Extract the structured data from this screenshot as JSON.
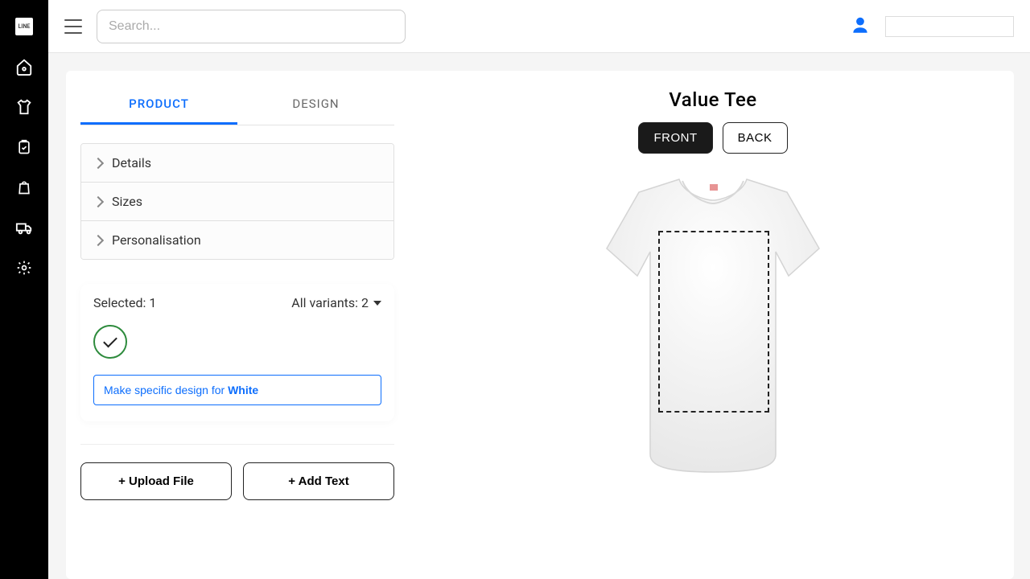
{
  "search": {
    "placeholder": "Search..."
  },
  "tabs": {
    "product": "PRODUCT",
    "design": "DESIGN"
  },
  "accordion": {
    "details": "Details",
    "sizes": "Sizes",
    "personalisation": "Personalisation"
  },
  "variants": {
    "selected_label": "Selected: 1",
    "all_label": "All variants: 2",
    "specific_prefix": "Make specific design for ",
    "specific_color": "White"
  },
  "actions": {
    "upload": "+ Upload File",
    "add_text": "+ Add Text"
  },
  "product": {
    "title": "Value Tee",
    "front": "FRONT",
    "back": "BACK"
  }
}
